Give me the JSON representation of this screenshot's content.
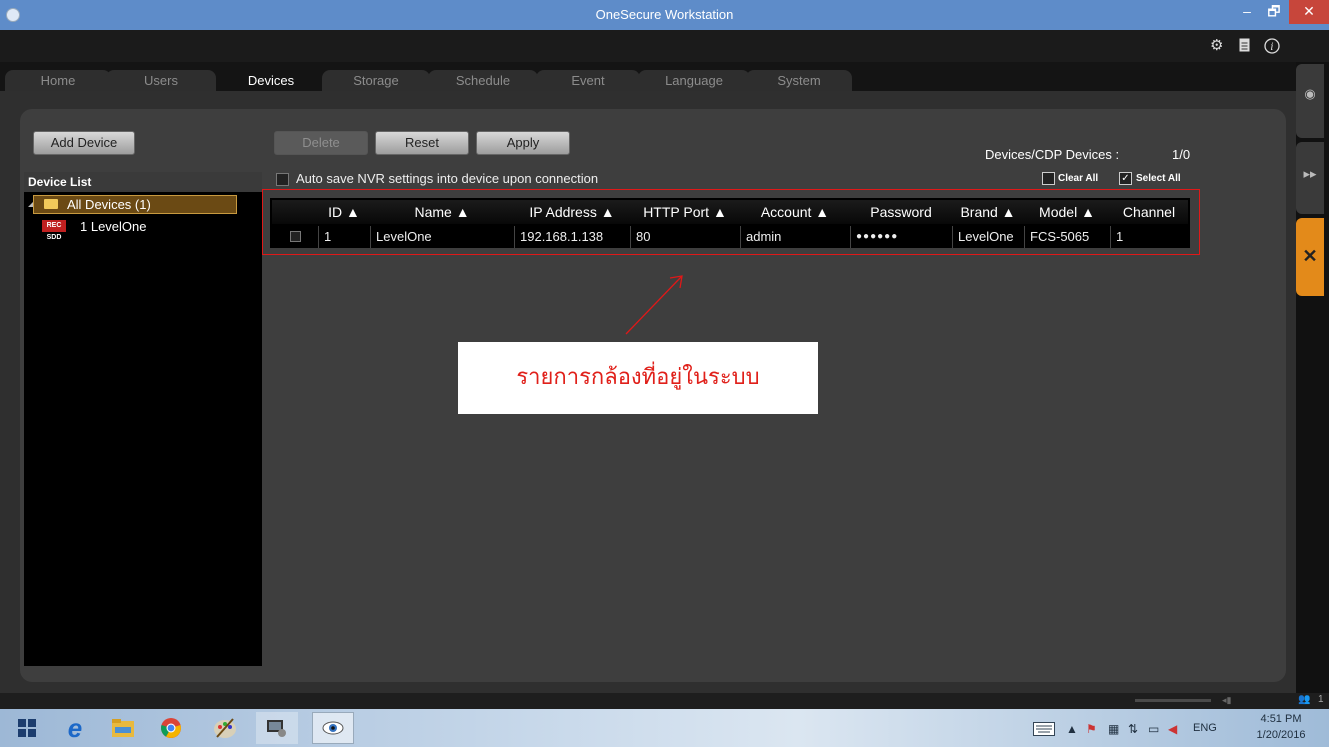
{
  "window": {
    "title": "OneSecure Workstation",
    "controls": {
      "minimize": "–",
      "restore": "🗗",
      "close": "✕"
    }
  },
  "toolbar_icons": [
    "gear-icon",
    "document-icon",
    "info-icon"
  ],
  "tabs": [
    {
      "label": "Home",
      "active": false
    },
    {
      "label": "Users",
      "active": false
    },
    {
      "label": "Devices",
      "active": true
    },
    {
      "label": "Storage",
      "active": false
    },
    {
      "label": "Schedule",
      "active": false
    },
    {
      "label": "Event",
      "active": false
    },
    {
      "label": "Language",
      "active": false
    },
    {
      "label": "System",
      "active": false
    }
  ],
  "left_panel": {
    "add_device_label": "Add Device",
    "device_list_header": "Device List",
    "tree": {
      "root_label": "All Devices (1)",
      "child_badge": "REC SDD",
      "child_label": "1 LevelOne"
    }
  },
  "actions": {
    "delete_label": "Delete",
    "reset_label": "Reset",
    "apply_label": "Apply"
  },
  "devices_summary": {
    "label": "Devices/CDP Devices :",
    "value": "1/0"
  },
  "auto_save_label": "Auto save NVR settings into device upon connection",
  "clear_all_label": "Clear All",
  "select_all_label": "Select All",
  "table": {
    "headers": [
      "ID ▲",
      "Name ▲",
      "IP Address ▲",
      "HTTP Port ▲",
      "Account ▲",
      "Password",
      "Brand ▲",
      "Model ▲",
      "Channel"
    ],
    "rows": [
      {
        "id": "1",
        "name": "LevelOne",
        "ip": "192.168.1.138",
        "http_port": "80",
        "account": "admin",
        "password": "●●●●●●",
        "brand": "LevelOne",
        "model": "FCS-5065",
        "channel": "1"
      }
    ]
  },
  "annotation": {
    "text": "รายการกล้องที่อยู่ในระบบ",
    "color": "#e0201a"
  },
  "statusbar": {
    "user_count": "1"
  },
  "taskbar": {
    "language": "ENG",
    "time": "4:51 PM",
    "date": "1/20/2016"
  },
  "colors": {
    "title_bar": "#5e8cc9",
    "accent_orange": "#e38a1a",
    "highlight_red": "#e01818"
  }
}
